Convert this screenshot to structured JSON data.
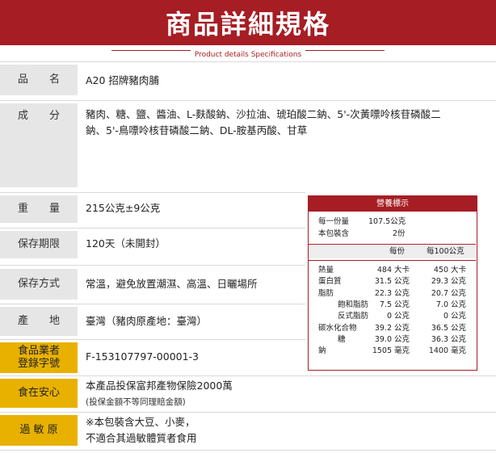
{
  "header": {
    "title": "商品詳細規格",
    "subtitle": "Product details Specifications"
  },
  "specs": {
    "name": {
      "label": "品　　名",
      "value": "A20 招牌豬肉脯"
    },
    "ingredients": {
      "label": "成　　分",
      "value_line1": "豬肉、糖、鹽、醬油、L-麩酸鈉、沙拉油、琥珀酸二鈉、5'-次黃嘌呤核苷磷酸二",
      "value_line2": "鈉、5'-鳥嘌呤核苷磷酸二鈉、DL-胺基丙酸、甘草"
    },
    "weight": {
      "label": "重　　量",
      "value": "215公克±9公克"
    },
    "shelf_life": {
      "label": "保存期限",
      "value": "120天（未開封）"
    },
    "storage": {
      "label": "保存方式",
      "value": "常溫，避免放置潮濕、高溫、日曬場所"
    },
    "origin": {
      "label": "產　　地",
      "value": "臺灣（豬肉原產地：臺灣）"
    },
    "registration": {
      "label_line1": "食品業者",
      "label_line2": "登錄字號",
      "value": "F-153107797-00001-3"
    },
    "insurance": {
      "label": "食在安心",
      "value_line1": "本產品投保富邦產物保險2000萬",
      "value_line2": "(投保金額不等同理賠金額)"
    },
    "allergen": {
      "label": "過 敏 原",
      "value_line1": "※本包裝含大豆、小麥，",
      "value_line2": "不適合其過敏體質者食用"
    }
  },
  "nutrition": {
    "title": "營養標示",
    "serving_label": "每一份量",
    "serving_value": "107.5公克",
    "servings_label": "本包裝含",
    "servings_value": "2份",
    "col_per_serving": "每份",
    "col_per_100g": "每100公克",
    "rows": [
      {
        "name": "熱量",
        "v1": "484",
        "u1": "大卡",
        "v2": "450",
        "u2": "大卡"
      },
      {
        "name": "蛋白質",
        "v1": "31.5",
        "u1": "公克",
        "v2": "29.3",
        "u2": "公克"
      },
      {
        "name": "脂肪",
        "v1": "22.3",
        "u1": "公克",
        "v2": "20.7",
        "u2": "公克"
      },
      {
        "name": "飽和脂肪",
        "v1": "7.5",
        "u1": "公克",
        "v2": "7.0",
        "u2": "公克"
      },
      {
        "name": "反式脂肪",
        "v1": "0",
        "u1": "公克",
        "v2": "0",
        "u2": "公克"
      },
      {
        "name": "碳水化合物",
        "v1": "39.2",
        "u1": "公克",
        "v2": "36.5",
        "u2": "公克"
      },
      {
        "name": "糖",
        "v1": "39.0",
        "u1": "公克",
        "v2": "36.3",
        "u2": "公克"
      },
      {
        "name": "鈉",
        "v1": "1505",
        "u1": "毫克",
        "v2": "1400",
        "u2": "毫克"
      }
    ]
  },
  "colors": {
    "brand_red": "#a61d24",
    "label_gray": "#e6e6e6",
    "label_gold": "#e8b100"
  }
}
